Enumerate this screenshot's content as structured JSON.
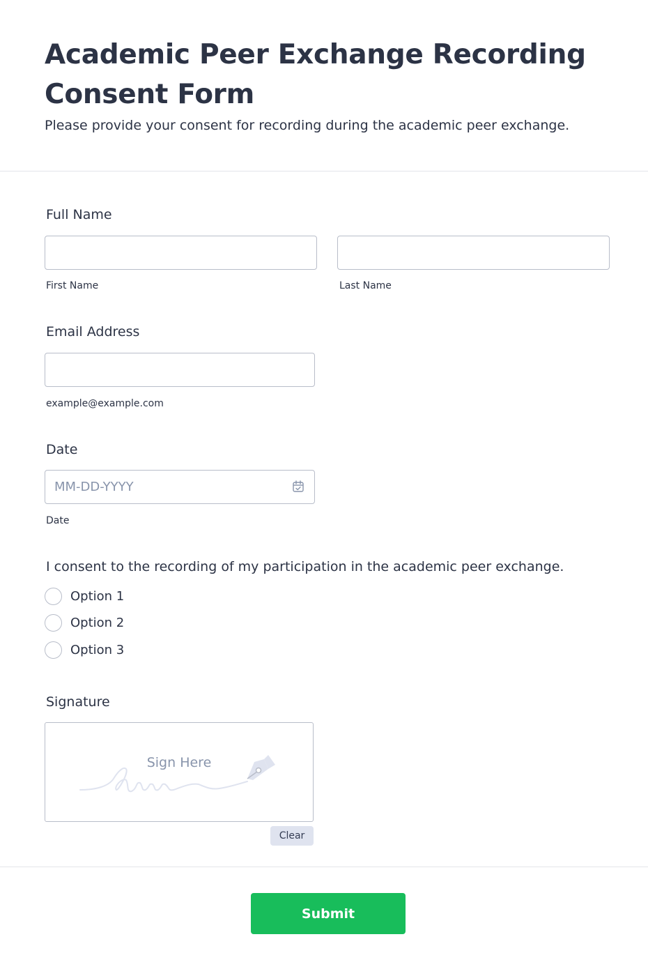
{
  "form": {
    "title": "Academic Peer Exchange Recording Consent Form",
    "description": "Please provide your consent for recording during the academic peer exchange."
  },
  "full_name": {
    "label": "Full Name",
    "first_value": "",
    "last_value": "",
    "first_sublabel": "First Name",
    "last_sublabel": "Last Name"
  },
  "email": {
    "label": "Email Address",
    "value": "",
    "sublabel": "example@example.com"
  },
  "date": {
    "label": "Date",
    "placeholder": "MM-DD-YYYY",
    "icon": "calendar-icon",
    "sublabel": "Date"
  },
  "consent": {
    "question": "I consent to the recording of my participation in the academic peer exchange.",
    "options": [
      "Option 1",
      "Option 2",
      "Option 3"
    ]
  },
  "signature": {
    "label": "Signature",
    "placeholder": "Sign Here",
    "icon": "pen-nib-icon",
    "clear_label": "Clear"
  },
  "submit": {
    "label": "Submit"
  },
  "colors": {
    "text": "#2c3345",
    "placeholder": "#8894ab",
    "border": "#b8bdc9",
    "submit": "#18bd5b",
    "clear_bg": "#dfe3ef"
  }
}
